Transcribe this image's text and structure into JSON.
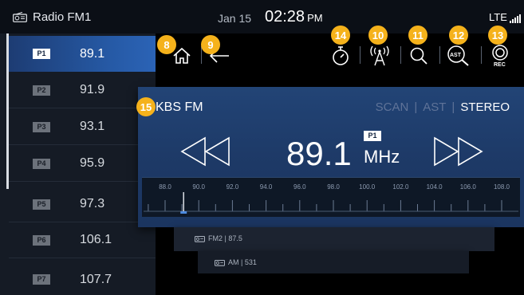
{
  "status_bar": {
    "app_title": "Radio FM1",
    "app_icon": "radio-icon",
    "date": "Jan 15",
    "time": "02:28",
    "ampm": "PM",
    "network": "LTE",
    "signal_icon": "signal-bars-icon"
  },
  "presets": [
    {
      "tag": "P1",
      "freq": "89.1",
      "active": true
    },
    {
      "tag": "P2",
      "freq": "91.9",
      "active": false
    },
    {
      "tag": "P3",
      "freq": "93.1",
      "active": false
    },
    {
      "tag": "P4",
      "freq": "95.9",
      "active": false
    },
    {
      "tag": "P5",
      "freq": "97.3",
      "active": false
    },
    {
      "tag": "P6",
      "freq": "106.1",
      "active": false
    },
    {
      "tag": "P7",
      "freq": "107.7",
      "active": false
    }
  ],
  "toolbar": {
    "home_icon": "home-icon",
    "back_icon": "back-arrow-icon",
    "timer_icon": "timer-icon",
    "antenna_icon": "antenna-icon",
    "search_icon": "search-icon",
    "ast_icon": "ast-search-icon",
    "ast_label": "AST",
    "rec_icon": "record-icon",
    "rec_label": "REC"
  },
  "callouts": {
    "home": "8",
    "back": "9",
    "antenna": "10",
    "search": "11",
    "ast": "12",
    "rec": "13",
    "timer": "14",
    "station": "15"
  },
  "tuner": {
    "station_name": "KBS FM",
    "mode_scan": "SCAN",
    "mode_ast": "AST",
    "mode_stereo": "STEREO",
    "preset_tag": "P1",
    "frequency": "89.1",
    "unit": "MHz",
    "seek_back_icon": "seek-back-icon",
    "seek_forward_icon": "seek-forward-icon",
    "dial_labels": [
      "88.0",
      "90.0",
      "92.0",
      "94.0",
      "96.0",
      "98.0",
      "100.0",
      "102.0",
      "104.0",
      "106.0",
      "108.0"
    ],
    "dial_min": 88.0,
    "dial_max": 108.0,
    "dial_needle_freq": 89.1
  },
  "sources": [
    {
      "label": "FM2 | 87.5",
      "icon": "radio-icon"
    },
    {
      "label": "AM | 531",
      "icon": "radio-icon"
    }
  ],
  "colors": {
    "accent_badge": "#f5b21b",
    "card_blue": "#224476",
    "active_preset": "#265aa6"
  }
}
